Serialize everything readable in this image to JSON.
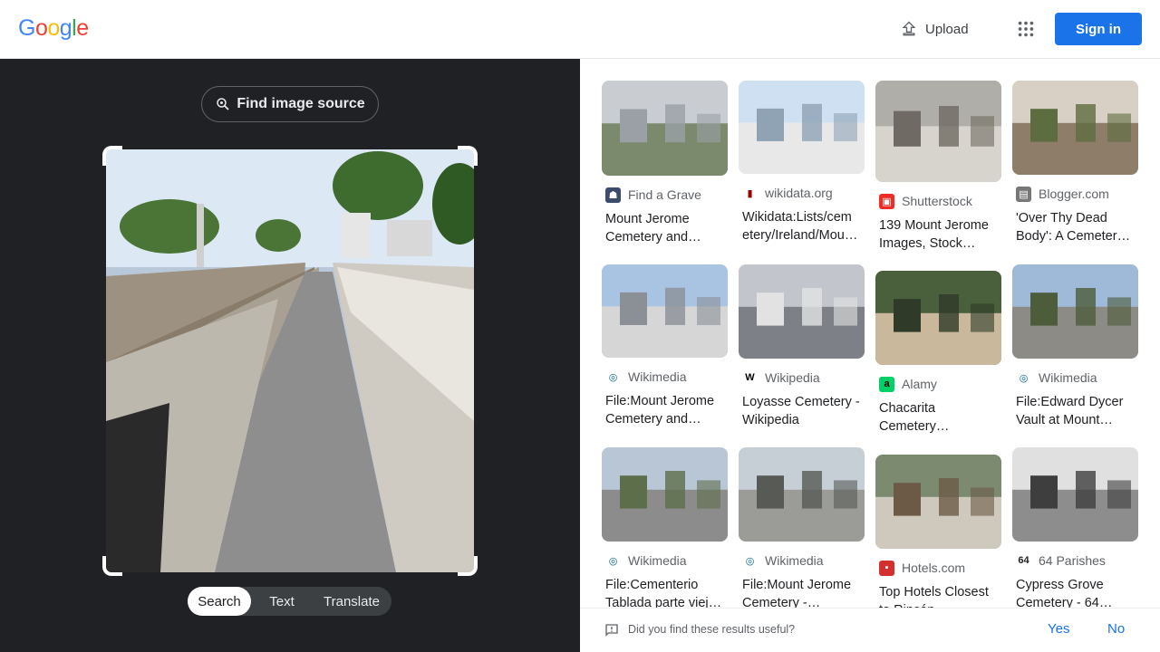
{
  "header": {
    "logo_letters": [
      "G",
      "o",
      "o",
      "g",
      "l",
      "e"
    ],
    "logo_colors": [
      "#4285f4",
      "#ea4335",
      "#fbbc05",
      "#4285f4",
      "#34a853",
      "#ea4335"
    ],
    "upload_label": "Upload",
    "apps_icon": "apps-grid-icon",
    "signin_label": "Sign in",
    "accent": "#1a73e8"
  },
  "left_panel": {
    "find_source_label": "Find image source",
    "modes": [
      {
        "label": "Search",
        "active": true
      },
      {
        "label": "Text",
        "active": false
      },
      {
        "label": "Translate",
        "active": false
      }
    ]
  },
  "results": [
    {
      "source": "Find a Grave",
      "favicon": "findagrave-icon",
      "title": "Mount Jerome Cemetery and…"
    },
    {
      "source": "wikidata.org",
      "favicon": "wikidata-icon",
      "title": "Wikidata:Lists/cem etery/Ireland/Mou…"
    },
    {
      "source": "Shutterstock",
      "favicon": "shutterstock-icon",
      "title": "139 Mount Jerome Images, Stock…"
    },
    {
      "source": "Blogger.com",
      "favicon": "blogger-icon",
      "title": "'Over Thy Dead Body': A Cemeter…"
    },
    {
      "source": "Wikimedia",
      "favicon": "wikimedia-icon",
      "title": "File:Mount Jerome Cemetery and…"
    },
    {
      "source": "Wikipedia",
      "favicon": "wikipedia-icon",
      "title": "Loyasse Cemetery - Wikipedia"
    },
    {
      "source": "Alamy",
      "favicon": "alamy-icon",
      "title": "Chacarita Cemetery…"
    },
    {
      "source": "Wikimedia",
      "favicon": "wikimedia-icon",
      "title": "File:Edward Dycer Vault at Mount…"
    },
    {
      "source": "Wikimedia",
      "favicon": "wikimedia-icon",
      "title": "File:Cementerio Tablada parte viej…"
    },
    {
      "source": "Wikimedia",
      "favicon": "wikimedia-icon",
      "title": "File:Mount Jerome Cemetery -…"
    },
    {
      "source": "Hotels.com",
      "favicon": "hotels-icon",
      "title": "Top Hotels Closest to Rincón…"
    },
    {
      "source": "64 Parishes",
      "favicon": "64-parishes-icon",
      "title": "Cypress Grove Cemetery - 64…"
    }
  ],
  "feedback": {
    "question": "Did you find these results useful?",
    "yes_label": "Yes",
    "no_label": "No"
  }
}
